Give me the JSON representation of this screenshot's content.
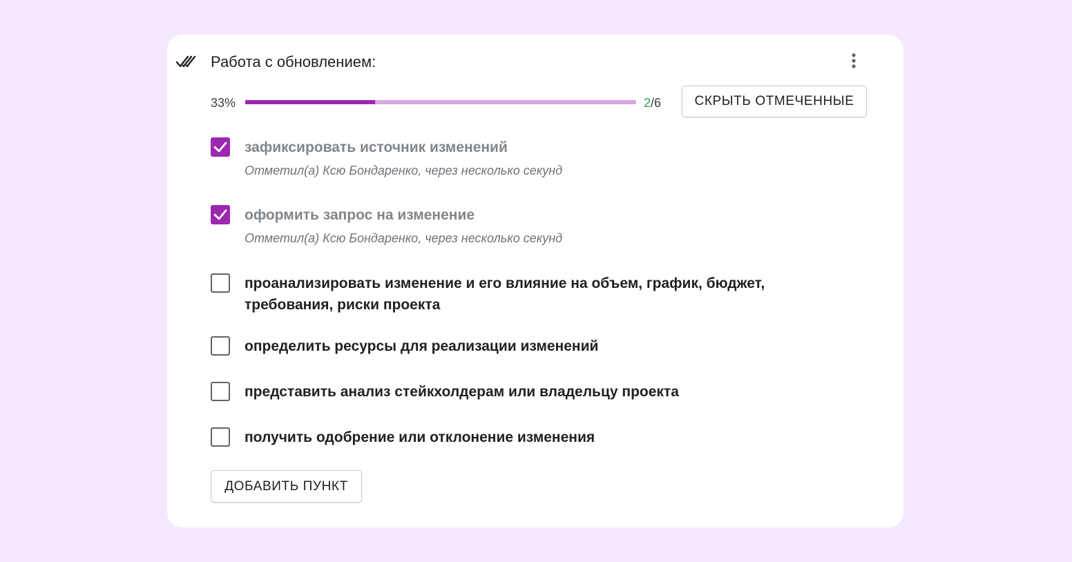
{
  "card": {
    "title": "Работа с обновлением:",
    "progress": {
      "percent_label": "33%",
      "fraction": 0.333,
      "done": "2",
      "total": "/6"
    },
    "hide_checked_label": "СКРЫТЬ ОТМЕЧЕННЫЕ",
    "add_item_label": "ДОБАВИТЬ ПУНКТ",
    "items": [
      {
        "text": "зафиксировать источник изменений",
        "checked": true,
        "meta": "Отметил(а) Ксю Бондаренко, через несколько секунд"
      },
      {
        "text": "оформить запрос на изменение",
        "checked": true,
        "meta": "Отметил(а) Ксю Бондаренко, через несколько секунд"
      },
      {
        "text": "проанализировать изменение и его влияние на объем, график, бюджет, требования, риски проекта",
        "checked": false
      },
      {
        "text": "определить ресурсы для реализации изменений",
        "checked": false
      },
      {
        "text": "представить анализ стейкхолдерам или владельцу проекта",
        "checked": false
      },
      {
        "text": "получить одобрение или отклонение изменения",
        "checked": false
      }
    ]
  },
  "colors": {
    "accent": "#9c27b0",
    "accent_light": "#dca6e4",
    "done_count": "#43a047",
    "page_background": "#f3e8fd"
  },
  "icons": {
    "header": "double-check-icon",
    "menu": "more-vertical-icon",
    "checkbox_checked": "checkmark-icon"
  }
}
